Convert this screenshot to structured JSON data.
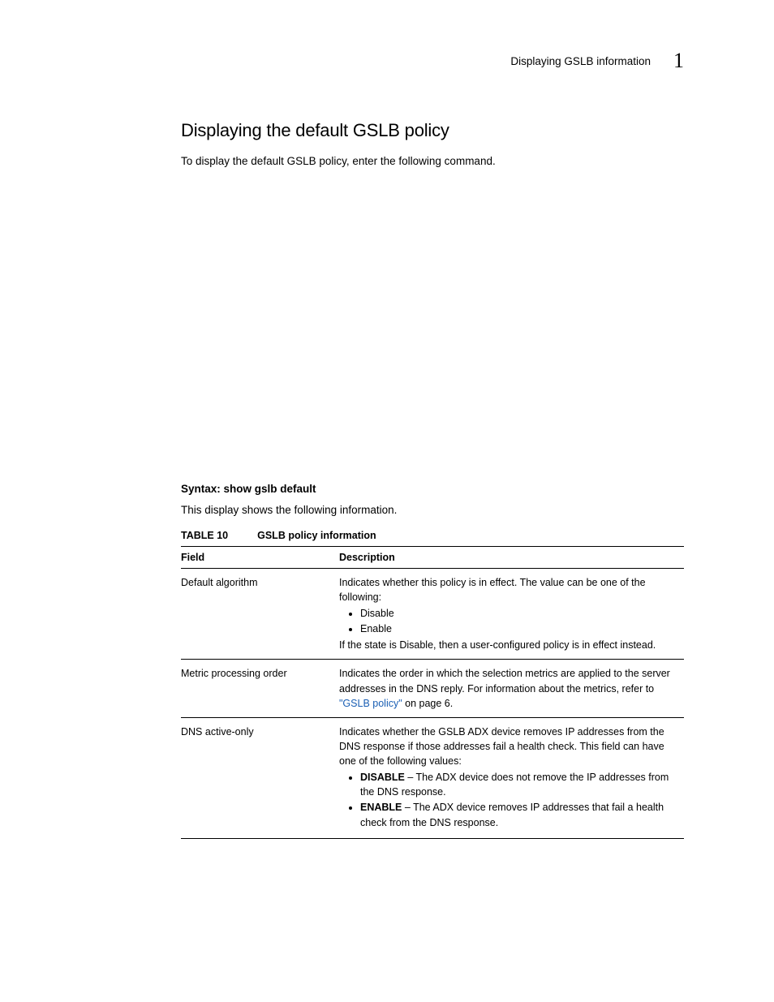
{
  "header": {
    "running_title": "Displaying GSLB information",
    "chapter_number": "1"
  },
  "section": {
    "title": "Displaying the default GSLB policy",
    "intro": "To display the default GSLB policy, enter the following command."
  },
  "syntax": {
    "label": "Syntax:",
    "command": "show gslb default"
  },
  "post_syntax": "This display shows the following information.",
  "table": {
    "caption_label": "TABLE 10",
    "caption_title": "GSLB policy information",
    "head_field": "Field",
    "head_desc": "Description",
    "rows": {
      "r0": {
        "field": "Default algorithm",
        "desc_pre": "Indicates whether this policy is in effect. The value can be one of the following:",
        "b1": "Disable",
        "b2": "Enable",
        "desc_post": "If the state is Disable, then a user-configured policy is in effect instead."
      },
      "r1": {
        "field": "Metric processing order",
        "desc_pre": "Indicates the order in which the selection metrics are applied to the server addresses in the DNS reply. For information about the metrics, refer to ",
        "link": "\"GSLB policy\"",
        "desc_post": " on page 6."
      },
      "r2": {
        "field": "DNS active-only",
        "desc_pre": "Indicates whether the GSLB ADX device removes IP addresses from the DNS response if those addresses fail a health check. This field can have one of the following values:",
        "b1_label": "DISABLE",
        "b1_rest": " – The ADX device does not remove the IP addresses from the DNS response.",
        "b2_label": "ENABLE",
        "b2_rest": " – The ADX device removes IP addresses that fail a health check from the DNS response."
      }
    }
  }
}
